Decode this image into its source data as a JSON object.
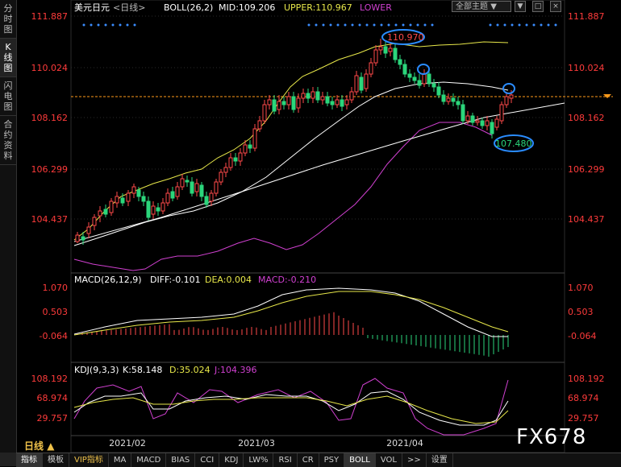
{
  "left_rail": [
    {
      "label": "分时图",
      "active": false
    },
    {
      "label": "K线图",
      "active": true
    },
    {
      "label": "闪电图",
      "active": false
    },
    {
      "label": "合约资料",
      "active": false
    }
  ],
  "main_header": {
    "symbol": "美元日元",
    "period": "<日线>",
    "indicator": "BOLL(26,2)",
    "mid": "MID:109.206",
    "upper": "UPPER:110.967",
    "lower": "LOWER"
  },
  "theme_select": "全部主题",
  "window_buttons": [
    "▼",
    "□",
    "×"
  ],
  "price_axis_left": [
    "111.887",
    "110.024",
    "108.162",
    "106.299",
    "104.437"
  ],
  "price_axis_right": [
    "111.887",
    "110.024",
    "108.162",
    "106.299",
    "104.437"
  ],
  "annotations": {
    "high": "110.970",
    "low": "107.480"
  },
  "macd": {
    "header": "MACD(26,12,9)",
    "diff": "DIFF:-0.101",
    "dea": "DEA:0.004",
    "macd": "MACD:-0.210",
    "axis": [
      "1.070",
      "0.503",
      "-0.064"
    ]
  },
  "kdj": {
    "header": "KDJ(9,3,3)",
    "k": "K:58.148",
    "d": "D:35.024",
    "j": "J:104.396",
    "axis": [
      "108.192",
      "68.974",
      "29.757"
    ]
  },
  "date_axis": [
    "2021/02",
    "2021/03",
    "2021/04"
  ],
  "period_label": "日线",
  "period_arrow": "▲",
  "bottom_tabs": [
    {
      "label": "指标",
      "active": true,
      "vip": false
    },
    {
      "label": "模板",
      "active": false,
      "vip": false
    },
    {
      "label": "VIP指标",
      "active": false,
      "vip": true
    },
    {
      "label": "MA",
      "active": false,
      "vip": false
    },
    {
      "label": "MACD",
      "active": false,
      "vip": false
    },
    {
      "label": "BIAS",
      "active": false,
      "vip": false
    },
    {
      "label": "CCI",
      "active": false,
      "vip": false
    },
    {
      "label": "KDJ",
      "active": false,
      "vip": false
    },
    {
      "label": "LW%",
      "active": false,
      "vip": false
    },
    {
      "label": "RSI",
      "active": false,
      "vip": false
    },
    {
      "label": "CR",
      "active": false,
      "vip": false
    },
    {
      "label": "PSY",
      "active": false,
      "vip": false
    },
    {
      "label": "BOLL",
      "active": true,
      "vip": false
    },
    {
      "label": "VOL",
      "active": false,
      "vip": false
    },
    {
      "label": ">>",
      "active": false,
      "vip": false
    },
    {
      "label": "设置",
      "active": false,
      "vip": false
    }
  ],
  "watermark": "FX678",
  "colors": {
    "up": "#ff4a4a",
    "down": "#2bd67b",
    "mid": "#ffffff",
    "upper": "#e8e84a",
    "lower": "#d040d0",
    "dea": "#e8e84a",
    "macd_label": "#d040d0",
    "axis_text": "#ff3b3b",
    "ref_line": "#ff9a1a",
    "highlight": "#2a8cff"
  }
}
